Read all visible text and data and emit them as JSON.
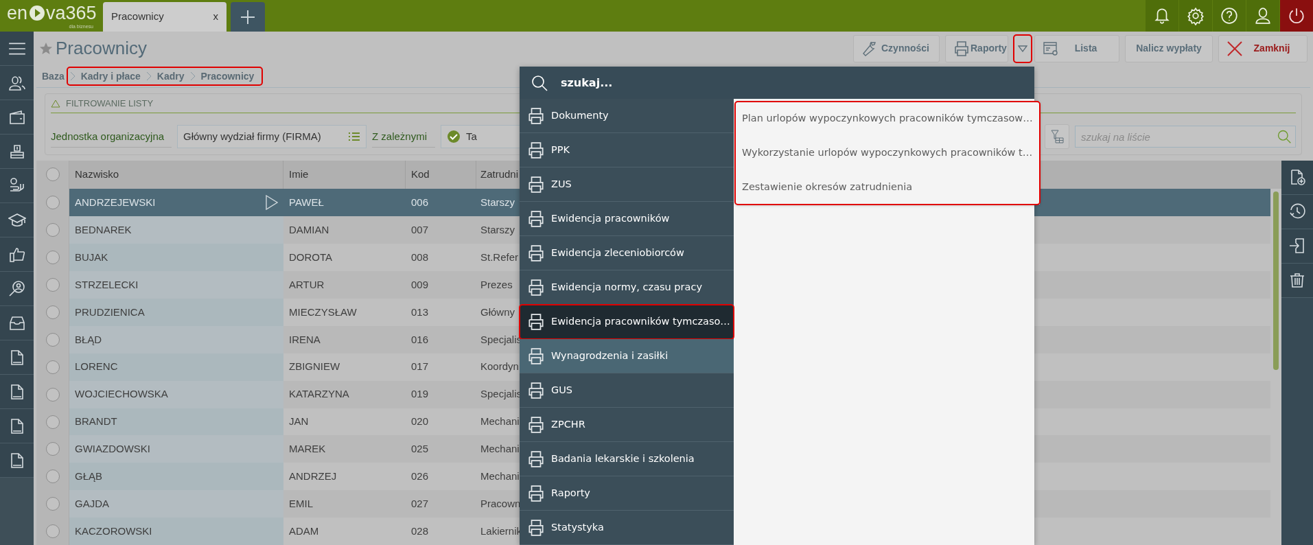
{
  "app": {
    "logo_start": "en",
    "logo_end": "va365",
    "tagline": "dla biznesu"
  },
  "tabs": [
    {
      "label": "Pracownicy",
      "close": "x",
      "selected": true
    }
  ],
  "topbar_icons": [
    {
      "kind": "bell"
    },
    {
      "kind": "gear"
    },
    {
      "kind": "help"
    },
    {
      "kind": "user"
    },
    {
      "kind": "power"
    }
  ],
  "sidebar": [
    {
      "kind": "menu"
    },
    {
      "kind": "people"
    },
    {
      "kind": "wallet"
    },
    {
      "kind": "cash"
    },
    {
      "kind": "coins"
    },
    {
      "kind": "cap"
    },
    {
      "kind": "thumb"
    },
    {
      "kind": "search-person"
    },
    {
      "kind": "tray"
    },
    {
      "kind": "doc"
    },
    {
      "kind": "doc"
    },
    {
      "kind": "doc"
    },
    {
      "kind": "doc"
    }
  ],
  "page": {
    "title": "Pracownicy"
  },
  "toolbar": [
    {
      "kind": "wrench",
      "label": "Czynności"
    },
    {
      "kind": "print",
      "label": "Raporty"
    },
    {
      "kind": "dropdown",
      "expanded": true,
      "highlighted": true
    },
    {
      "kind": "list",
      "label": "Lista"
    },
    {
      "kind": "plain",
      "label": "Nalicz wypłaty"
    },
    {
      "kind": "close",
      "label": "Zamknij"
    }
  ],
  "breadcrumb": {
    "root": "Baza",
    "path": [
      "Kadry i płace",
      "Kadry",
      "Pracownicy"
    ],
    "highlighted": true
  },
  "filter": {
    "title": "FILTROWANIE LISTY",
    "unit_label": "Jednostka organizacyjna",
    "unit_value": "Główny wydział firmy (FIRMA)",
    "sub_label": "Z zależnymi",
    "check_label": "Ta",
    "checked": true,
    "search_placeholder": "szukaj na liście"
  },
  "table": {
    "all_checked": false,
    "columns": [
      "Nazwisko",
      "Imie",
      "Kod",
      "Zatrudni"
    ],
    "rows": [
      {
        "cells": [
          "ANDRZEJEWSKI",
          "PAWEŁ",
          "006",
          "Starszy"
        ],
        "selected": true,
        "checked": false
      },
      {
        "cells": [
          "BEDNAREK",
          "DAMIAN",
          "007",
          "Starszy"
        ],
        "selected": false,
        "checked": false
      },
      {
        "cells": [
          "BUJAK",
          "DOROTA",
          "008",
          "St.Refer"
        ],
        "selected": false,
        "checked": false
      },
      {
        "cells": [
          "STRZELECKI",
          "ARTUR",
          "009",
          "Prezes"
        ],
        "selected": false,
        "checked": false
      },
      {
        "cells": [
          "PRUDZIENICA",
          "MIECZYSŁAW",
          "013",
          "Główny"
        ],
        "selected": false,
        "checked": false
      },
      {
        "cells": [
          "BŁĄD",
          "IRENA",
          "016",
          "Specjalis"
        ],
        "selected": false,
        "checked": false
      },
      {
        "cells": [
          "LORENC",
          "ZBIGNIEW",
          "017",
          "Koordyn"
        ],
        "selected": false,
        "checked": false
      },
      {
        "cells": [
          "WOJCIECHOWSKA",
          "KATARZYNA",
          "019",
          "Specjalis"
        ],
        "selected": false,
        "checked": false
      },
      {
        "cells": [
          "BRANDT",
          "JAN",
          "020",
          "Mechani"
        ],
        "selected": false,
        "checked": false
      },
      {
        "cells": [
          "GWIAZDOWSKI",
          "MAREK",
          "025",
          "Mechani"
        ],
        "selected": false,
        "checked": false
      },
      {
        "cells": [
          "GŁĄB",
          "ANDRZEJ",
          "026",
          "Mechani"
        ],
        "selected": false,
        "checked": false
      },
      {
        "cells": [
          "GAJDA",
          "EMIL",
          "027",
          "Pracown"
        ],
        "selected": false,
        "checked": false
      },
      {
        "cells": [
          "KACZOROWSKI",
          "ADAM",
          "028",
          "Lakiernik"
        ],
        "selected": false,
        "checked": false
      }
    ]
  },
  "right_toolbar": [
    {
      "kind": "new-doc"
    },
    {
      "kind": "history"
    },
    {
      "kind": "import"
    },
    {
      "kind": "trash"
    }
  ],
  "menu": {
    "search_placeholder": "szukaj...",
    "items": [
      {
        "label": "Dokumenty",
        "selected": false,
        "hovered": false
      },
      {
        "label": "PPK",
        "selected": false,
        "hovered": false
      },
      {
        "label": "ZUS",
        "selected": false,
        "hovered": false
      },
      {
        "label": "Ewidencja pracowników",
        "selected": false,
        "hovered": false
      },
      {
        "label": "Ewidencja zleceniobiorców",
        "selected": false,
        "hovered": false
      },
      {
        "label": "Ewidencja normy, czasu pracy",
        "selected": false,
        "hovered": false
      },
      {
        "label": "Ewidencja pracowników tymczaso…",
        "selected": true,
        "hovered": false
      },
      {
        "label": "Wynagrodzenia i zasiłki",
        "selected": false,
        "hovered": true
      },
      {
        "label": "GUS",
        "selected": false,
        "hovered": false
      },
      {
        "label": "ZPCHR",
        "selected": false,
        "hovered": false
      },
      {
        "label": "Badania lekarskie i szkolenia",
        "selected": false,
        "hovered": false
      },
      {
        "label": "Raporty",
        "selected": false,
        "hovered": false
      },
      {
        "label": "Statystyka",
        "selected": false,
        "hovered": false
      }
    ],
    "submenu": {
      "highlighted": true,
      "items": [
        "Plan urlopów wypoczynkowych pracowników tymczasow…",
        "Wykorzystanie urlopów wypoczynkowych pracowników t…",
        "Zestawienie okresów zatrudnienia"
      ]
    }
  }
}
